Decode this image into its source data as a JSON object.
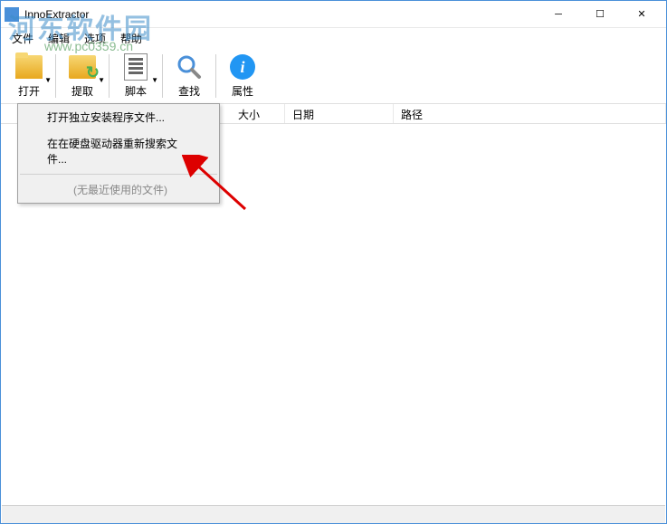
{
  "window": {
    "title": "InnoExtractor"
  },
  "menubar": {
    "items": [
      "文件",
      "编辑",
      "选项",
      "帮助"
    ]
  },
  "toolbar": {
    "open": "打开",
    "extract": "提取",
    "script": "脚本",
    "find": "查找",
    "properties": "属性"
  },
  "columns": {
    "size": "大小",
    "date": "日期",
    "path": "路径"
  },
  "context_menu": {
    "open_standalone": "打开独立安装程序文件...",
    "search_hdd": "在在硬盘驱动器重新搜索文件...",
    "no_recent": "(无最近使用的文件)"
  },
  "watermark": {
    "text": "河东软件园",
    "url": "www.pc0359.cn"
  }
}
